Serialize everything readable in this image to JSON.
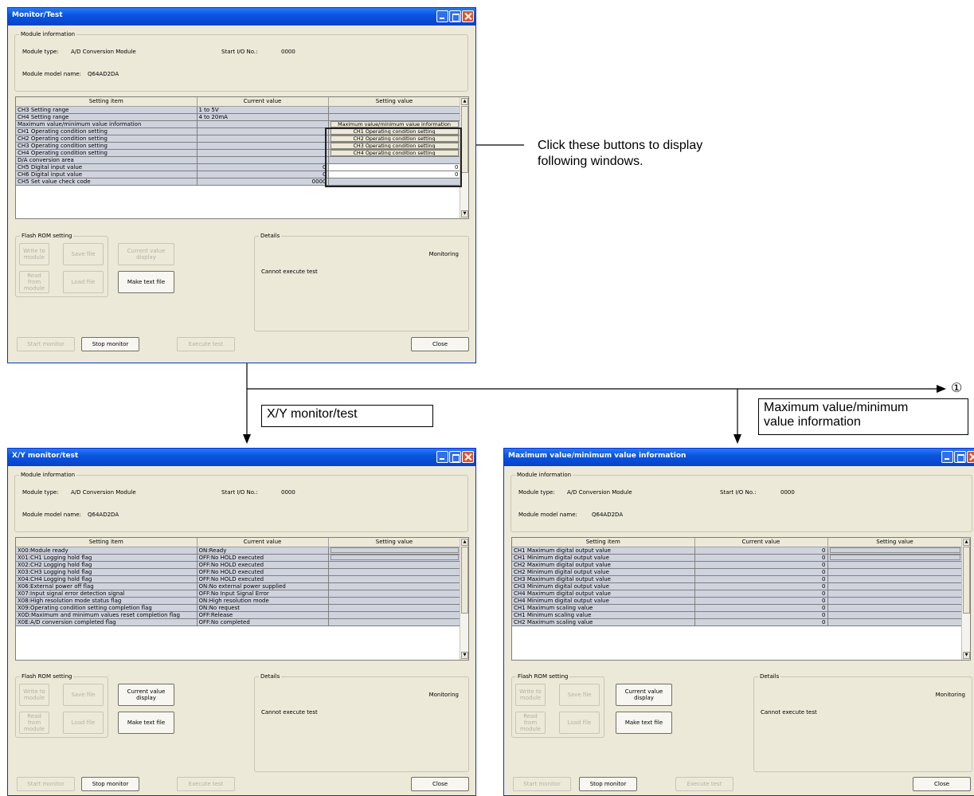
{
  "annotations": {
    "click_note": "Click these buttons to display\nfollowing windows.",
    "label_xy": "X/Y monitor/test",
    "label_maxmin": "Maximum value/minimum\nvalue information",
    "circled_1": "①"
  },
  "common": {
    "module_info_legend": "Module information",
    "module_type_label": "Module type:",
    "module_type_value": "A/D Conversion Module",
    "start_io_label": "Start I/O No.:",
    "start_io_value": "0000",
    "model_name_label": "Module model name:",
    "model_name_value": "Q64AD2DA",
    "col_setting_item": "Setting item",
    "col_current_value": "Current value",
    "col_setting_value": "Setting value",
    "flash_legend": "Flash ROM setting",
    "write_to_module": "Write to module",
    "save_file": "Save file",
    "current_value_display": "Current value display",
    "read_from_module": "Read from module",
    "load_file": "Load file",
    "make_text_file": "Make text file",
    "details_legend": "Details",
    "monitoring": "Monitoring",
    "cannot_execute": "Cannot execute test",
    "start_monitor": "Start monitor",
    "stop_monitor": "Stop monitor",
    "execute_test": "Execute test",
    "close": "Close"
  },
  "win_main": {
    "title": "Monitor/Test",
    "rows": [
      {
        "item": "CH3 Setting range",
        "current": "1 to 5V",
        "setting": "",
        "kind": "plain"
      },
      {
        "item": "CH4 Setting range",
        "current": "4 to 20mA",
        "setting": "",
        "kind": "plain"
      },
      {
        "item": "Maximum value/minimum value information",
        "current": "",
        "setting": "Maximum value/minimum value information",
        "kind": "button"
      },
      {
        "item": "CH1 Operating condition setting",
        "current": "",
        "setting": "CH1 Operating condition setting",
        "kind": "button"
      },
      {
        "item": "CH2 Operating condition setting",
        "current": "",
        "setting": "CH2 Operating condition setting",
        "kind": "button"
      },
      {
        "item": "CH3 Operating condition setting",
        "current": "",
        "setting": "CH3 Operating condition setting",
        "kind": "button"
      },
      {
        "item": "CH4 Operating condition setting",
        "current": "",
        "setting": "CH4 Operating condition setting",
        "kind": "button"
      },
      {
        "item": "D/A conversion area",
        "current": "",
        "setting": "",
        "kind": "plain"
      },
      {
        "item": "CH5 Digital input value",
        "current": "0",
        "setting": "0",
        "kind": "input"
      },
      {
        "item": "CH6 Digital input value",
        "current": "0",
        "setting": "0",
        "kind": "input"
      },
      {
        "item": "CH5 Set value check code",
        "current": "0000",
        "setting": "",
        "kind": "plain"
      }
    ]
  },
  "win_xy": {
    "title": "X/Y monitor/test",
    "rows": [
      {
        "item": "X00:Module ready",
        "current": "ON:Ready"
      },
      {
        "item": "X01:CH1 Logging hold flag",
        "current": "OFF:No HOLD executed"
      },
      {
        "item": "X02:CH2 Logging hold flag",
        "current": "OFF:No HOLD executed"
      },
      {
        "item": "X03:CH3 Logging hold flag",
        "current": "OFF:No HOLD executed"
      },
      {
        "item": "X04:CH4 Logging hold flag",
        "current": "OFF:No HOLD executed"
      },
      {
        "item": "X06:External power off flag",
        "current": "ON:No external power supplied"
      },
      {
        "item": "X07:Input signal error detection signal",
        "current": "OFF:No Input Signal Error"
      },
      {
        "item": "X08:High resolution mode status flag",
        "current": "ON:High resolution mode"
      },
      {
        "item": "X09:Operating condition setting completion flag",
        "current": "ON:No request"
      },
      {
        "item": "X0D:Maximum and minimum values reset completion flag",
        "current": "OFF:Release"
      },
      {
        "item": "X0E:A/D conversion completed flag",
        "current": "OFF:No completed"
      }
    ]
  },
  "win_maxmin": {
    "title": "Maximum value/minimum value information",
    "rows": [
      {
        "item": "CH1 Maximum digital output value",
        "current": "0"
      },
      {
        "item": "CH1 Minimum digital output value",
        "current": "0"
      },
      {
        "item": "CH2 Maximum digital output value",
        "current": "0"
      },
      {
        "item": "CH2 Minimum digital output value",
        "current": "0"
      },
      {
        "item": "CH3 Maximum digital output value",
        "current": "0"
      },
      {
        "item": "CH3 Minimum digital output value",
        "current": "0"
      },
      {
        "item": "CH4 Maximum digital output value",
        "current": "0"
      },
      {
        "item": "CH4 Minimum digital output value",
        "current": "0"
      },
      {
        "item": "CH1 Maximum scaling value",
        "current": "0"
      },
      {
        "item": "CH1 Minimum scaling value",
        "current": "0"
      },
      {
        "item": "CH2 Maximum scaling value",
        "current": "0"
      }
    ]
  }
}
